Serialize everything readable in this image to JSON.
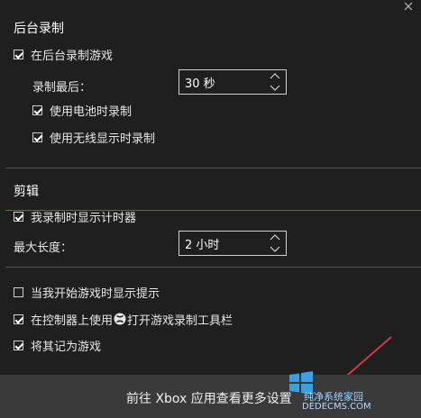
{
  "sections": {
    "background_recording": {
      "title": "后台录制",
      "record_game": "在后台录制游戏",
      "record_last_label": "录制最后：",
      "record_last_value": "30 秒",
      "battery_record": "使用电池时录制",
      "wireless_record": "使用无线显示时录制"
    },
    "clips": {
      "title": "剪辑",
      "show_timer": "我录制时显示计时器",
      "max_length_label": "最大长度：",
      "max_length_value": "2 小时"
    },
    "other": {
      "show_tips": "当我开始游戏时显示提示",
      "controller_prefix": "在控制器上使用",
      "controller_suffix": "打开游戏录制工具栏",
      "remember_game": "将其记为游戏"
    }
  },
  "footer": {
    "link_text": "前往 Xbox 应用查看更多设置"
  },
  "watermark": {
    "line1": "纯净系统家园",
    "line2": "DEDECMS.COM"
  },
  "colors": {
    "background": "#1f1f1f",
    "footer_bg": "#3a3a3a",
    "red_line": "#c23a3a"
  },
  "icons": [
    "close-icon",
    "checkbox-icon",
    "spinner-up-icon",
    "spinner-down-icon",
    "xbox-icon",
    "windows-logo-icon"
  ]
}
